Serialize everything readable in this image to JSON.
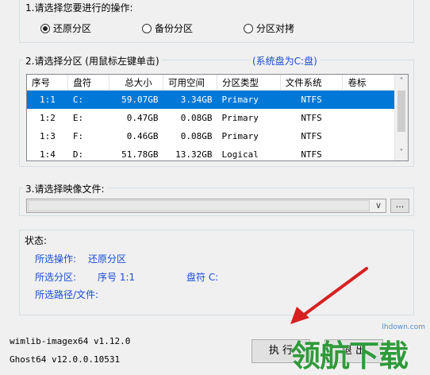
{
  "section1": {
    "title": "1.请选择您要进行的操作:",
    "options": [
      {
        "label": "还原分区",
        "checked": true
      },
      {
        "label": "备份分区",
        "checked": false
      },
      {
        "label": "分区对拷",
        "checked": false
      }
    ]
  },
  "section2": {
    "title": "2.请选择分区 (用鼠标左键单击)",
    "system_disk": "(系统盘为C:盘)",
    "columns": [
      "序号",
      "盘符",
      "总大小",
      "可用空间",
      "分区类型",
      "文件系统",
      "卷标"
    ],
    "rows": [
      {
        "idx": "1:1",
        "drive": "C:",
        "size": "59.07GB",
        "free": "3.34GB",
        "type": "Primary",
        "fs": "NTFS",
        "label": ""
      },
      {
        "idx": "1:2",
        "drive": "E:",
        "size": "0.47GB",
        "free": "0.08GB",
        "type": "Primary",
        "fs": "NTFS",
        "label": ""
      },
      {
        "idx": "1:3",
        "drive": "F:",
        "size": "0.46GB",
        "free": "0.08GB",
        "type": "Primary",
        "fs": "NTFS",
        "label": ""
      },
      {
        "idx": "1:4",
        "drive": "D:",
        "size": "51.78GB",
        "free": "13.32GB",
        "type": "Logical",
        "fs": "NTFS",
        "label": ""
      }
    ]
  },
  "section3": {
    "title": "3.请选择映像文件:",
    "combo_value": "",
    "browse_label": "..."
  },
  "status": {
    "title": "状态:",
    "operation_label": "所选操作:",
    "operation_value": "还原分区",
    "partition_label": "所选分区:",
    "partition_idx": "序号 1:1",
    "partition_drive": "盘符 C:",
    "path_label": "所选路径/文件:"
  },
  "footer": {
    "wimlib": "wimlib-imagex64 v1.12.0",
    "ghost": "Ghost64 v12.0.0.10531",
    "execute_label": "执 行",
    "exit_label": "退 出"
  },
  "watermark": {
    "text": "领航下载",
    "url": "lhdown.com"
  },
  "colors": {
    "selection": "#0078d7",
    "link_blue": "#1a4cd6",
    "watermark_green": "#2f9a3a",
    "arrow_red": "#d62020"
  }
}
